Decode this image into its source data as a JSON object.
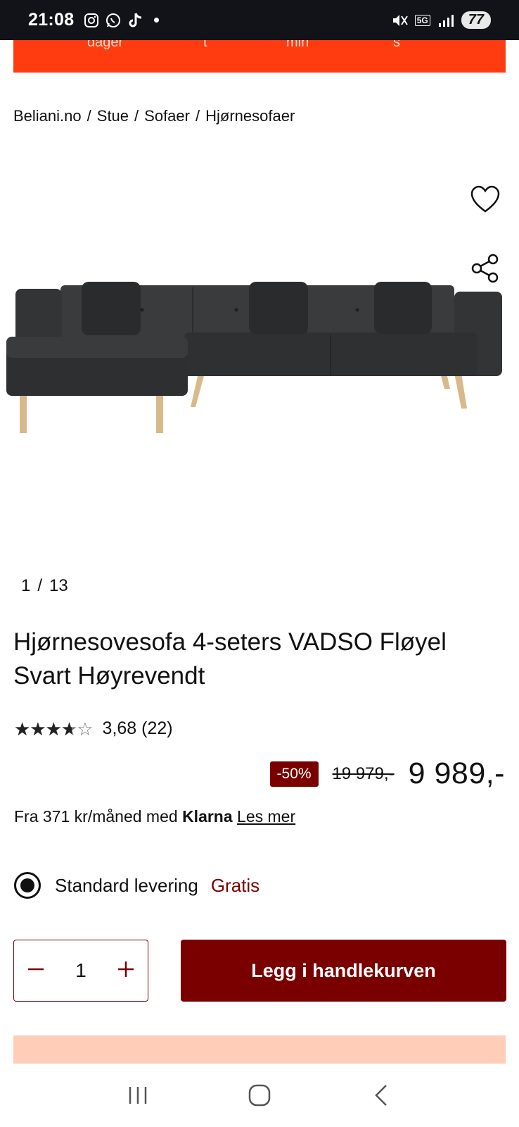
{
  "status_bar": {
    "time": "21:08",
    "left_icons": [
      "instagram-icon",
      "whatsapp-icon",
      "tiktok-icon"
    ],
    "network": "5G",
    "battery": "77"
  },
  "countdown": {
    "labels": [
      "dager",
      "t",
      "min",
      "s"
    ],
    "color": "#ff3b10"
  },
  "breadcrumb": [
    "Beliani.no",
    "Stue",
    "Sofaer",
    "Hjørnesofaer"
  ],
  "gallery": {
    "current": "1",
    "separator": "/",
    "total": "13"
  },
  "product": {
    "title": "Hjørnesovesofa 4-seters VADSO Fløyel Svart Høyrevendt",
    "rating_value": 3.68,
    "rating_text": "3,68",
    "review_count": "(22)",
    "discount": "-50%",
    "old_price": "19 979,-",
    "price": "9 989,-"
  },
  "financing": {
    "prefix": "Fra 371 kr/måned med",
    "brand": "Klarna",
    "link": "Les mer"
  },
  "delivery": {
    "label": "Standard levering",
    "price": "Gratis"
  },
  "cart": {
    "quantity": "1",
    "button": "Legg i handlekurven"
  },
  "colors": {
    "accent": "#7a0000",
    "promo": "#ffcdb8"
  }
}
